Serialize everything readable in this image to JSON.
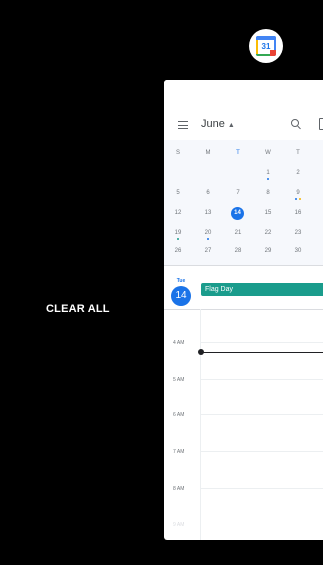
{
  "app_icon": {
    "label": "31"
  },
  "recents": {
    "clear_all": "CLEAR ALL"
  },
  "calendar": {
    "header": {
      "month": "June",
      "caret": "▲"
    },
    "weekdays": [
      "S",
      "M",
      "T",
      "W",
      "T"
    ],
    "weeks": [
      [
        "",
        "",
        "",
        "1",
        "2"
      ],
      [
        "5",
        "6",
        "7",
        "8",
        "9"
      ],
      [
        "12",
        "13",
        "14",
        "15",
        "16"
      ],
      [
        "19",
        "20",
        "21",
        "22",
        "23"
      ],
      [
        "26",
        "27",
        "28",
        "29",
        "30"
      ]
    ],
    "today": {
      "dow": "Tue",
      "num": "14"
    },
    "event": {
      "title": "Flag Day"
    },
    "hours": [
      "4 AM",
      "5 AM",
      "6 AM",
      "7 AM",
      "8 AM",
      "9 AM"
    ],
    "colors": {
      "accent": "#1a73e8",
      "event": "#1a9c8c"
    }
  }
}
